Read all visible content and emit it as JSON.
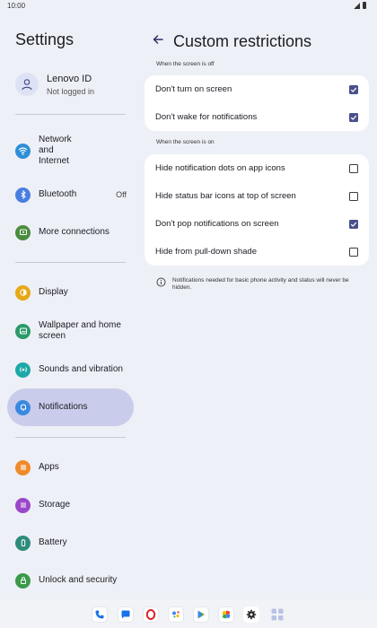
{
  "status_bar": {
    "time": "10:00"
  },
  "left": {
    "title": "Settings",
    "account": {
      "name": "Lenovo ID",
      "status": "Not logged in"
    },
    "items": [
      {
        "label": "Network and Internet",
        "icon": "wifi-icon",
        "color": "#2d8fd8"
      },
      {
        "label": "Bluetooth",
        "value": "Off",
        "icon": "bluetooth-icon",
        "color": "#4a7fe0"
      },
      {
        "label": "More connections",
        "icon": "connections-icon",
        "color": "#4a8c3f"
      },
      {
        "label": "Display",
        "icon": "brightness-icon",
        "color": "#e6a817"
      },
      {
        "label": "Wallpaper and home screen",
        "icon": "wallpaper-icon",
        "color": "#2a9a6a"
      },
      {
        "label": "Sounds and vibration",
        "icon": "sound-icon",
        "color": "#1ea8a8"
      },
      {
        "label": "Notifications",
        "icon": "bell-icon",
        "color": "#3a89e0",
        "selected": true
      },
      {
        "label": "Apps",
        "icon": "apps-icon",
        "color": "#f08a2a"
      },
      {
        "label": "Storage",
        "icon": "storage-icon",
        "color": "#9b47c9"
      },
      {
        "label": "Battery",
        "icon": "battery-icon",
        "color": "#2d8c7c"
      },
      {
        "label": "Unlock and security",
        "icon": "lock-icon",
        "color": "#3a9a4a"
      }
    ]
  },
  "right": {
    "title": "Custom restrictions",
    "sections": [
      {
        "label": "When the screen is off",
        "rows": [
          {
            "label": "Don't turn on screen",
            "checked": true
          },
          {
            "label": "Don't wake for notifications",
            "checked": true
          }
        ]
      },
      {
        "label": "When the screen is on",
        "rows": [
          {
            "label": "Hide notification dots on app icons",
            "checked": false
          },
          {
            "label": "Hide status bar icons at top of screen",
            "checked": false
          },
          {
            "label": "Don't pop notifications on screen",
            "checked": true
          },
          {
            "label": "Hide from pull-down shade",
            "checked": false
          }
        ]
      }
    ],
    "info": "Notifications needed for basic phone activity and status will never be hidden."
  },
  "dock": {
    "apps": [
      "phone-icon",
      "messages-icon",
      "opera-icon",
      "assistant-icon",
      "play-store-icon",
      "photos-icon",
      "settings-icon",
      "app-drawer-icon"
    ]
  },
  "colors": {
    "accent": "#49508a",
    "selected_bg": "#c9ccea",
    "background": "#eef0f7"
  }
}
